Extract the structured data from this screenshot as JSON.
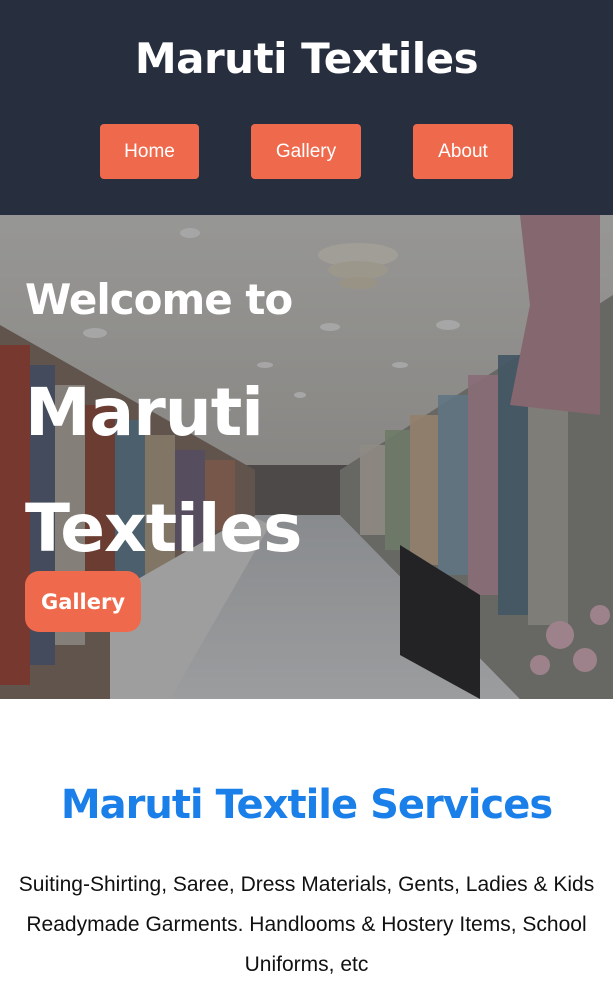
{
  "header": {
    "title": "Maruti Textiles",
    "nav": [
      {
        "label": "Home"
      },
      {
        "label": "Gallery"
      },
      {
        "label": "About"
      }
    ]
  },
  "hero": {
    "welcome": "Welcome to",
    "name": "Maruti Textiles",
    "button_label": "Gallery",
    "background": "textile-store-interior-photo"
  },
  "services": {
    "title": "Maruti Textile Services",
    "description": "Suiting-Shirting, Saree, Dress Materials, Gents, Ladies & Kids Readymade Garments. Handlooms & Hostery Items, School Uniforms, etc"
  },
  "colors": {
    "header_bg": "#272f3f",
    "accent": "#ef6a4c",
    "services_title": "#1a7fe8"
  }
}
